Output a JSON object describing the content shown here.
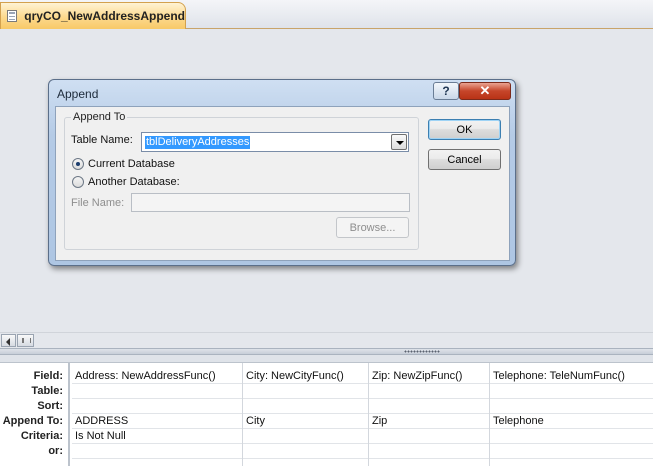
{
  "tab": {
    "label": "qryCO_NewAddressAppend",
    "icon": "query-icon"
  },
  "dialog": {
    "title": "Append",
    "help_symbol": "?",
    "close_symbol": "✕",
    "group_title": "Append To",
    "table_name_label": "Table Name:",
    "table_name_value": "tblDeliveryAddresses",
    "current_db_label": "Current Database",
    "current_db_selected": true,
    "another_db_label": "Another Database:",
    "file_name_label": "File Name:",
    "file_name_value": "",
    "browse_label": "Browse...",
    "ok_label": "OK",
    "cancel_label": "Cancel"
  },
  "grid": {
    "row_labels": [
      "Field:",
      "Table:",
      "Sort:",
      "Append To:",
      "Criteria:",
      "or:"
    ],
    "columns": [
      {
        "field": "Address: NewAddressFunc()",
        "table": "",
        "sort": "",
        "append_to": "ADDRESS",
        "criteria": "Is Not Null",
        "or": ""
      },
      {
        "field": "City: NewCityFunc()",
        "table": "",
        "sort": "",
        "append_to": "City",
        "criteria": "",
        "or": ""
      },
      {
        "field": "Zip: NewZipFunc()",
        "table": "",
        "sort": "",
        "append_to": "Zip",
        "criteria": "",
        "or": ""
      },
      {
        "field": "Telephone: TeleNumFunc()",
        "table": "",
        "sort": "",
        "append_to": "Telephone",
        "criteria": "",
        "or": ""
      }
    ]
  },
  "colors": {
    "tab_accent": "#f8c968",
    "selection": "#3399ff",
    "close_button": "#c6452a"
  }
}
